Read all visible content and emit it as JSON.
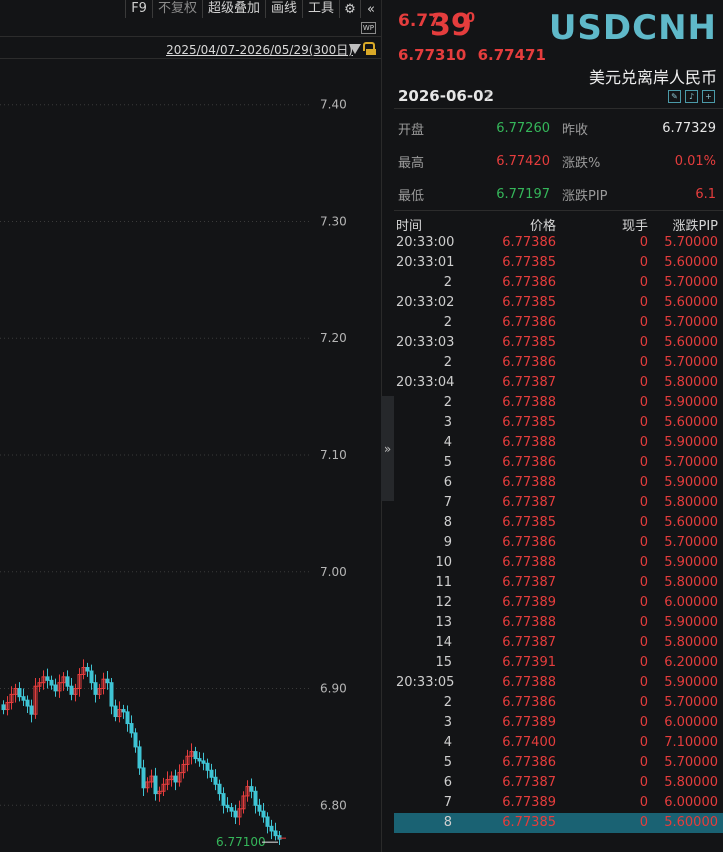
{
  "toolbar": {
    "items": [
      "F9",
      "不复权",
      "超级叠加",
      "画线",
      "工具"
    ],
    "icons": [
      "gear-icon",
      "double-chevron-left-icon"
    ],
    "wp_badge": "WP"
  },
  "chart": {
    "range_label": "2025/04/07-2026/05/29(300日)",
    "y_ticks": [
      "7.40",
      "7.30",
      "7.20",
      "7.10",
      "7.00",
      "6.90",
      "6.80"
    ],
    "last_price_label": "6.77100",
    "colors": {
      "up": "#e53d3d",
      "down": "#3fc4d4",
      "grid": "#3a3a3a"
    }
  },
  "chart_data": {
    "type": "candlestick",
    "ylim": [
      6.76,
      7.44
    ],
    "candles_close": [
      6.882,
      6.888,
      6.895,
      6.9,
      6.893,
      6.89,
      6.885,
      6.878,
      6.902,
      6.905,
      6.91,
      6.907,
      6.903,
      6.898,
      6.905,
      6.91,
      6.902,
      6.895,
      6.9,
      6.912,
      6.918,
      6.915,
      6.905,
      6.895,
      6.9,
      6.908,
      6.905,
      6.885,
      6.876,
      6.882,
      6.88,
      6.87,
      6.862,
      6.85,
      6.832,
      6.815,
      6.82,
      6.825,
      6.81,
      6.812,
      6.818,
      6.822,
      6.825,
      6.82,
      6.828,
      6.835,
      6.842,
      6.846,
      6.84,
      6.838,
      6.836,
      6.83,
      6.824,
      6.818,
      6.81,
      6.8,
      6.798,
      6.795,
      6.79,
      6.797,
      6.808,
      6.816,
      6.812,
      6.8,
      6.795,
      6.79,
      6.782,
      6.778,
      6.774,
      6.771
    ]
  },
  "quote": {
    "price_prefix": "6.77",
    "price_big": "39",
    "price_sup": "0",
    "bid": "6.77310",
    "ask": "6.77471",
    "symbol": "USDCNH",
    "name_cn": "美元兑离岸人民币",
    "date": "2026-06-02",
    "help": "?"
  },
  "stats": {
    "open_label": "开盘",
    "open": "6.77260",
    "prev_label": "昨收",
    "prev": "6.77329",
    "high_label": "最高",
    "high": "6.77420",
    "chg_pct_label": "涨跌%",
    "chg_pct": "0.01%",
    "low_label": "最低",
    "low": "6.77197",
    "pip_label": "涨跌PIP",
    "pip": "6.1"
  },
  "ticks": {
    "headers": [
      "时间",
      "价格",
      "现手",
      "涨跌PIP"
    ],
    "rows": [
      {
        "t": "20:33:00",
        "p": "6.77386",
        "v": "0",
        "c": "5.70000"
      },
      {
        "t": "20:33:01",
        "p": "6.77385",
        "v": "0",
        "c": "5.60000"
      },
      {
        "t": "2",
        "p": "6.77386",
        "v": "0",
        "c": "5.70000"
      },
      {
        "t": "20:33:02",
        "p": "6.77385",
        "v": "0",
        "c": "5.60000"
      },
      {
        "t": "2",
        "p": "6.77386",
        "v": "0",
        "c": "5.70000"
      },
      {
        "t": "20:33:03",
        "p": "6.77385",
        "v": "0",
        "c": "5.60000"
      },
      {
        "t": "2",
        "p": "6.77386",
        "v": "0",
        "c": "5.70000"
      },
      {
        "t": "20:33:04",
        "p": "6.77387",
        "v": "0",
        "c": "5.80000"
      },
      {
        "t": "2",
        "p": "6.77388",
        "v": "0",
        "c": "5.90000"
      },
      {
        "t": "3",
        "p": "6.77385",
        "v": "0",
        "c": "5.60000"
      },
      {
        "t": "4",
        "p": "6.77388",
        "v": "0",
        "c": "5.90000"
      },
      {
        "t": "5",
        "p": "6.77386",
        "v": "0",
        "c": "5.70000"
      },
      {
        "t": "6",
        "p": "6.77388",
        "v": "0",
        "c": "5.90000"
      },
      {
        "t": "7",
        "p": "6.77387",
        "v": "0",
        "c": "5.80000"
      },
      {
        "t": "8",
        "p": "6.77385",
        "v": "0",
        "c": "5.60000"
      },
      {
        "t": "9",
        "p": "6.77386",
        "v": "0",
        "c": "5.70000"
      },
      {
        "t": "10",
        "p": "6.77388",
        "v": "0",
        "c": "5.90000"
      },
      {
        "t": "11",
        "p": "6.77387",
        "v": "0",
        "c": "5.80000"
      },
      {
        "t": "12",
        "p": "6.77389",
        "v": "0",
        "c": "6.00000"
      },
      {
        "t": "13",
        "p": "6.77388",
        "v": "0",
        "c": "5.90000"
      },
      {
        "t": "14",
        "p": "6.77387",
        "v": "0",
        "c": "5.80000"
      },
      {
        "t": "15",
        "p": "6.77391",
        "v": "0",
        "c": "6.20000"
      },
      {
        "t": "20:33:05",
        "p": "6.77388",
        "v": "0",
        "c": "5.90000"
      },
      {
        "t": "2",
        "p": "6.77386",
        "v": "0",
        "c": "5.70000"
      },
      {
        "t": "3",
        "p": "6.77389",
        "v": "0",
        "c": "6.00000"
      },
      {
        "t": "4",
        "p": "6.77400",
        "v": "0",
        "c": "7.10000"
      },
      {
        "t": "5",
        "p": "6.77386",
        "v": "0",
        "c": "5.70000"
      },
      {
        "t": "6",
        "p": "6.77387",
        "v": "0",
        "c": "5.80000"
      },
      {
        "t": "7",
        "p": "6.77389",
        "v": "0",
        "c": "6.00000"
      },
      {
        "t": "8",
        "p": "6.77385",
        "v": "0",
        "c": "5.60000"
      }
    ]
  }
}
